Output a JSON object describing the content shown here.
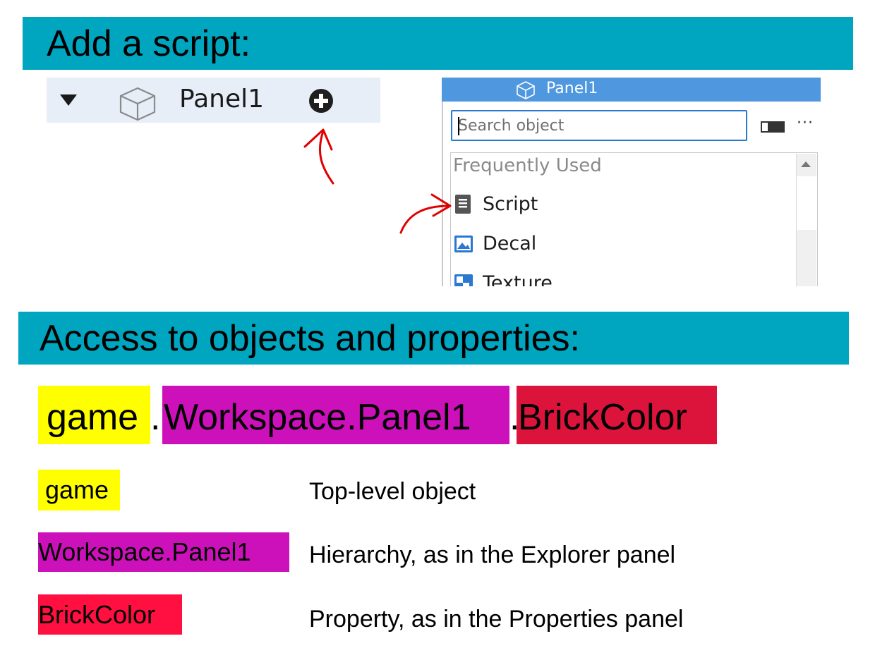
{
  "sections": {
    "add_script_title": "Add a script:",
    "access_title": "Access to objects and properties:"
  },
  "explorer": {
    "item_label": "Panel1",
    "icons": [
      "collapse-arrow-icon",
      "part-cube-icon",
      "insert-object-plus-icon"
    ]
  },
  "insert_popup": {
    "header_title": "Panel1",
    "search_placeholder": "Search object",
    "section_label": "Frequently Used",
    "items": [
      {
        "label": "Script",
        "icon": "script-icon"
      },
      {
        "label": "Decal",
        "icon": "decal-icon"
      },
      {
        "label": "Texture",
        "icon": "texture-icon"
      }
    ],
    "more_label": "···"
  },
  "expression": {
    "game": "game",
    "dot1": ".",
    "workspace_path": "Workspace.Panel1",
    "dot2": ".",
    "property": "BrickColor"
  },
  "legend": [
    {
      "term": "game",
      "description": "Top-level object",
      "color": "#ffff00"
    },
    {
      "term": "Workspace.Panel1",
      "description": "Hierarchy, as in the Explorer panel",
      "color": "#cc11bb"
    },
    {
      "term": "BrickColor",
      "description": "Property, as in the Properties panel",
      "color": "#ff1040"
    }
  ],
  "colors": {
    "banner": "#00a5c0",
    "popup_header": "#4f97de",
    "annotation_arrow": "#e00000"
  }
}
